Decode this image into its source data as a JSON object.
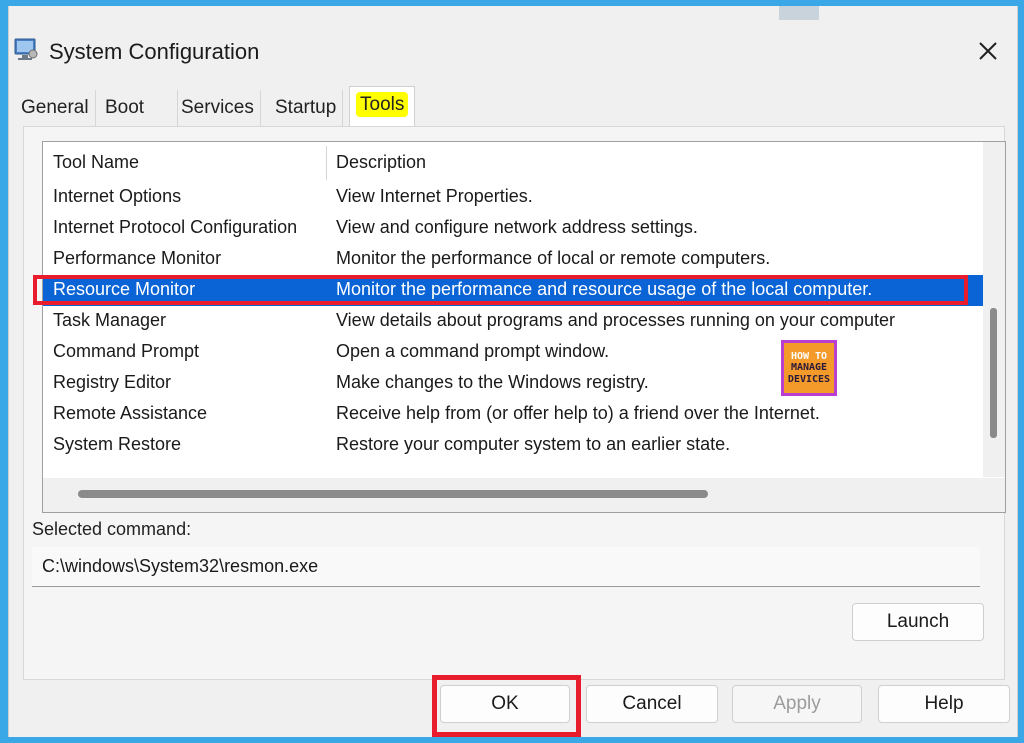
{
  "window": {
    "title": "System Configuration"
  },
  "tabs": [
    {
      "label": "General"
    },
    {
      "label": "Boot"
    },
    {
      "label": "Services"
    },
    {
      "label": "Startup"
    },
    {
      "label": "Tools",
      "active": true
    }
  ],
  "tool_list": {
    "headers": {
      "tool": "Tool Name",
      "description": "Description"
    },
    "rows": [
      {
        "tool": "Internet Options",
        "description": "View Internet Properties."
      },
      {
        "tool": "Internet Protocol Configuration",
        "description": "View and configure network address settings."
      },
      {
        "tool": "Performance Monitor",
        "description": "Monitor the performance of local or remote computers."
      },
      {
        "tool": "Resource Monitor",
        "description": "Monitor the performance and resource usage of the local computer.",
        "selected": true
      },
      {
        "tool": "Task Manager",
        "description": "View details about programs and processes running on your computer"
      },
      {
        "tool": "Command Prompt",
        "description": "Open a command prompt window."
      },
      {
        "tool": "Registry Editor",
        "description": "Make changes to the Windows registry."
      },
      {
        "tool": "Remote Assistance",
        "description": "Receive help from (or offer help to) a friend over the Internet."
      },
      {
        "tool": "System Restore",
        "description": "Restore your computer system to an earlier state."
      }
    ]
  },
  "selected_command": {
    "label": "Selected command:",
    "value": "C:\\windows\\System32\\resmon.exe"
  },
  "buttons": {
    "launch": "Launch",
    "ok": "OK",
    "cancel": "Cancel",
    "apply": "Apply",
    "help": "Help"
  },
  "watermark": {
    "line1": "HOW TO",
    "line2": "MANAGE",
    "line3": "DEVICES"
  },
  "colors": {
    "selection": "#0a64d6",
    "highlight_box": "#e81c2c",
    "tab_highlight": "#ffff00",
    "frame": "#3aa8e6"
  }
}
